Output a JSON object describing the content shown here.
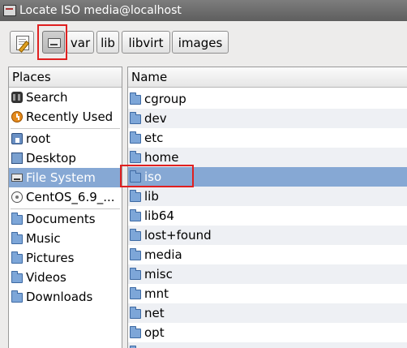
{
  "window": {
    "title": "Locate ISO media@localhost"
  },
  "pathbar": {
    "edit_icon": "edit-location-icon",
    "root_icon": "drive-icon",
    "segments": [
      "var",
      "lib",
      "libvirt",
      "images"
    ]
  },
  "places": {
    "header": "Places",
    "items": [
      {
        "label": "Search",
        "icon": "binoculars-icon"
      },
      {
        "label": "Recently Used",
        "icon": "recent-icon"
      },
      {
        "label": "root",
        "icon": "home-folder-icon"
      },
      {
        "label": "Desktop",
        "icon": "desktop-icon"
      },
      {
        "label": "File System",
        "icon": "drive-icon",
        "selected": true
      },
      {
        "label": "CentOS_6.9_...",
        "icon": "disc-icon"
      },
      {
        "label": "Documents",
        "icon": "folder-icon"
      },
      {
        "label": "Music",
        "icon": "folder-icon"
      },
      {
        "label": "Pictures",
        "icon": "folder-icon"
      },
      {
        "label": "Videos",
        "icon": "folder-icon"
      },
      {
        "label": "Downloads",
        "icon": "folder-icon"
      }
    ]
  },
  "files": {
    "header": "Name",
    "rows": [
      "cgroup",
      "dev",
      "etc",
      "home",
      "iso",
      "lib",
      "lib64",
      "lost+found",
      "media",
      "misc",
      "mnt",
      "net",
      "opt",
      "proc"
    ],
    "selected": "iso"
  },
  "colors": {
    "selection": "#86a8d4",
    "highlight_box": "#e02020",
    "folder": "#7da6d8"
  }
}
